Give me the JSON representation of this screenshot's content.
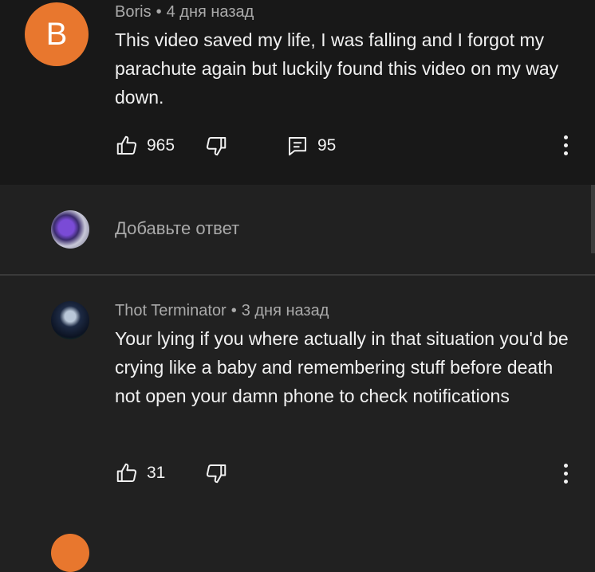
{
  "comments": [
    {
      "author": "Boris",
      "time": "4 дня назад",
      "avatar_letter": "B",
      "text": "This video saved my life, I was falling and I forgot my parachute  again but luckily  found this video on my way down.",
      "likes": "965",
      "replies": "95"
    },
    {
      "author": "Thot Terminator",
      "time": "3 дня назад",
      "text": "Your lying if you where actually in that situation you'd be crying like a baby and remembering stuff before death not open your damn phone to check notifications",
      "likes": "31"
    }
  ],
  "reply_box": {
    "placeholder": "Добавьте ответ"
  },
  "meta_separator": "•",
  "colors": {
    "background": "#212121",
    "highlight_background": "#181818",
    "avatar_orange": "#e8772e",
    "secondary_text": "#aaaaaa"
  },
  "icons": {
    "like": "thumbs-up-icon",
    "dislike": "thumbs-down-icon",
    "reply": "comment-icon",
    "more": "more-vert-icon"
  }
}
